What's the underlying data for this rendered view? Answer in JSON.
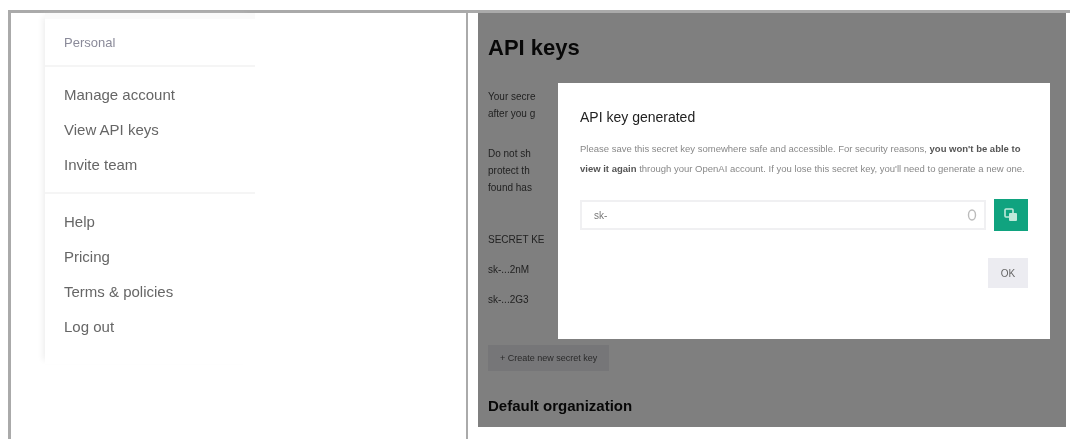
{
  "sidebar": {
    "heading": "Personal",
    "groups": [
      {
        "items": [
          {
            "label": "Manage account"
          },
          {
            "label": "View API keys"
          },
          {
            "label": "Invite team"
          }
        ]
      },
      {
        "items": [
          {
            "label": "Help"
          },
          {
            "label": "Pricing"
          },
          {
            "label": "Terms & policies"
          },
          {
            "label": "Log out"
          }
        ]
      }
    ]
  },
  "page": {
    "title": "API keys",
    "paragraphs": [
      [
        "Your secre",
        "after you g"
      ],
      [
        "Do not sh",
        "protect th",
        "found has"
      ]
    ],
    "keys_table": {
      "header": "SECRET KE",
      "rows": [
        "sk-...2nM",
        "sk-...2G3"
      ]
    },
    "create_button": "+ Create new secret key",
    "section_title": "Default organization"
  },
  "dialog": {
    "title": "API key generated",
    "message": "Please save this secret key somewhere safe and accessible. For security reasons, **you won't be able to view it again** through your OpenAI account. If you lose this secret key, you'll need to generate a new one.",
    "key_value": "sk-",
    "ok_button": "OK"
  }
}
